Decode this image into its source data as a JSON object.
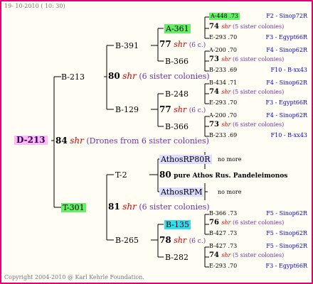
{
  "header": {
    "date": "19- 10-2010 ( 10: 30)"
  },
  "footer": {
    "copyright": "Copyright 2004-2010 @ Karl Kehrle Foundation."
  },
  "root": {
    "id": "D-213",
    "gen": "84",
    "shr": "shr",
    "note": "(Drones from 6 sister colonies)"
  },
  "left": {
    "b213": {
      "id": "B-213",
      "gen": "80",
      "shr": "shr",
      "note": "(6 sister colonies)"
    },
    "t301": {
      "id": "T-301",
      "gen": "81",
      "shr": "shr",
      "note": "(6 sister colonies)"
    }
  },
  "mid": {
    "b391": "B-391",
    "b129": "B-129",
    "t2": "T-2",
    "b265": "B-265"
  },
  "right": {
    "a361": {
      "id": "A-361",
      "gen": "77",
      "shr": "shr",
      "note": "(6 c.)"
    },
    "b366a": "B-366",
    "b248": "B-248",
    "b129g": {
      "gen": "77",
      "shr": "shr",
      "note": "(6 c.)"
    },
    "b366b": "B-366",
    "athos80": "AthosRP80R",
    "athosline": {
      "gen": "80",
      "text": "pure Athos Rus. Pandeleimonos"
    },
    "athosrpm": "AthosRPM",
    "nomore1": "no more",
    "nomore2": "no more",
    "b135": {
      "id": "B-135",
      "gen": "78",
      "shr": "shr",
      "note": "(6 c.)"
    },
    "b282": "B-282"
  },
  "far": [
    {
      "id": "A-448 .73",
      "src": "F2 - Sinop72R"
    },
    {
      "gen": "74",
      "shr": "shr",
      "note": "(5 sister colonies)"
    },
    {
      "id": "E-293 .70",
      "src": "F3 - Egypt66R"
    },
    {
      "id": "A-200 .70",
      "src": "F4 - Sinop62R"
    },
    {
      "gen": "73",
      "shr": "shr",
      "note": "(6 sister colonies)"
    },
    {
      "id": "B-233 .69",
      "src": "F10 - B-xx43"
    },
    {
      "id": "B-434 .71",
      "src": "F4 - Sinop62R"
    },
    {
      "gen": "74",
      "shr": "shr",
      "note": "(5 sister colonies)"
    },
    {
      "id": "E-293 .70",
      "src": "F3 - Egypt66R"
    },
    {
      "id": "A-200 .70",
      "src": "F4 - Sinop62R"
    },
    {
      "gen": "73",
      "shr": "shr",
      "note": "(6 sister colonies)"
    },
    {
      "id": "B-233 .69",
      "src": "F10 - B-xx43"
    },
    {
      "id": "B-366 .73",
      "src": "F5 - Sinop62R"
    },
    {
      "gen": "76",
      "shr": "shr",
      "note": "(6 sister colonies)"
    },
    {
      "id": "B-427 .73",
      "src": "F5 - Sinop62R"
    },
    {
      "id": "B-427 .73",
      "src": "F5 - Sinop62R"
    },
    {
      "gen": "74",
      "shr": "shr",
      "note": "(5 sister colonies)"
    },
    {
      "id": "E-293 .70",
      "src": "F3 - Egypt66R"
    }
  ]
}
